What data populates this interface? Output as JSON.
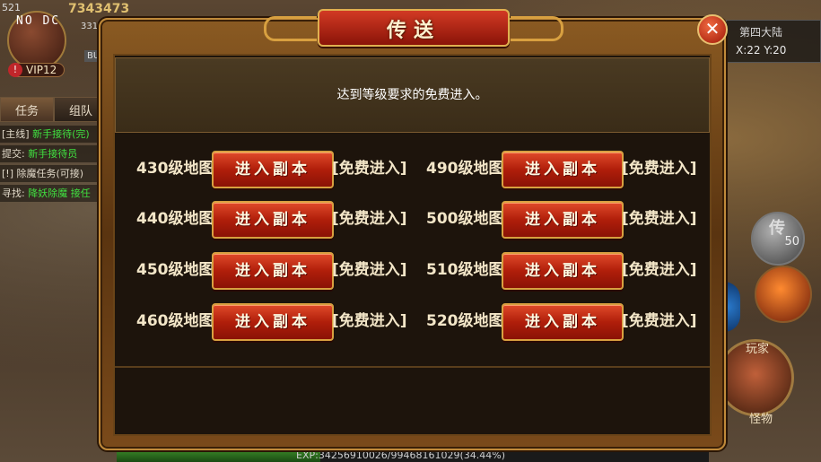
{
  "hud": {
    "overlay_tag": "NO DC",
    "level": "521",
    "power": "7343473",
    "power_sub": "331",
    "vip": "VIP12",
    "bu_label": "BU",
    "tabs": [
      "任务",
      "组队"
    ],
    "tasks": [
      {
        "prefix": "[主线]",
        "text": "新手接待(完)"
      },
      {
        "prefix": "提交:",
        "text": "新手接待员"
      },
      {
        "prefix": "[!]",
        "text": "除魔任务(可接)"
      },
      {
        "prefix": "寻找:",
        "text": "降妖除魔 接任"
      }
    ],
    "map_name": "第四大陆",
    "coords": "X:22 Y:20",
    "orb_glyph": "传",
    "orb_count": "50",
    "player_label": "玩家",
    "monster_label": "怪物",
    "exp_text": "EXP:34256910026/99468161029(34.44%)",
    "exp_progress": 0.3444
  },
  "dialog": {
    "title": "传送",
    "close_label": "✕",
    "info": "达到等级要求的免费进入。",
    "button_label": "进入副本",
    "free_tag": "[免费进入]",
    "maps": [
      {
        "left": "430级地图",
        "right": "490级地图"
      },
      {
        "left": "440级地图",
        "right": "500级地图"
      },
      {
        "left": "450级地图",
        "right": "510级地图"
      },
      {
        "left": "460级地图",
        "right": "520级地图"
      }
    ]
  }
}
